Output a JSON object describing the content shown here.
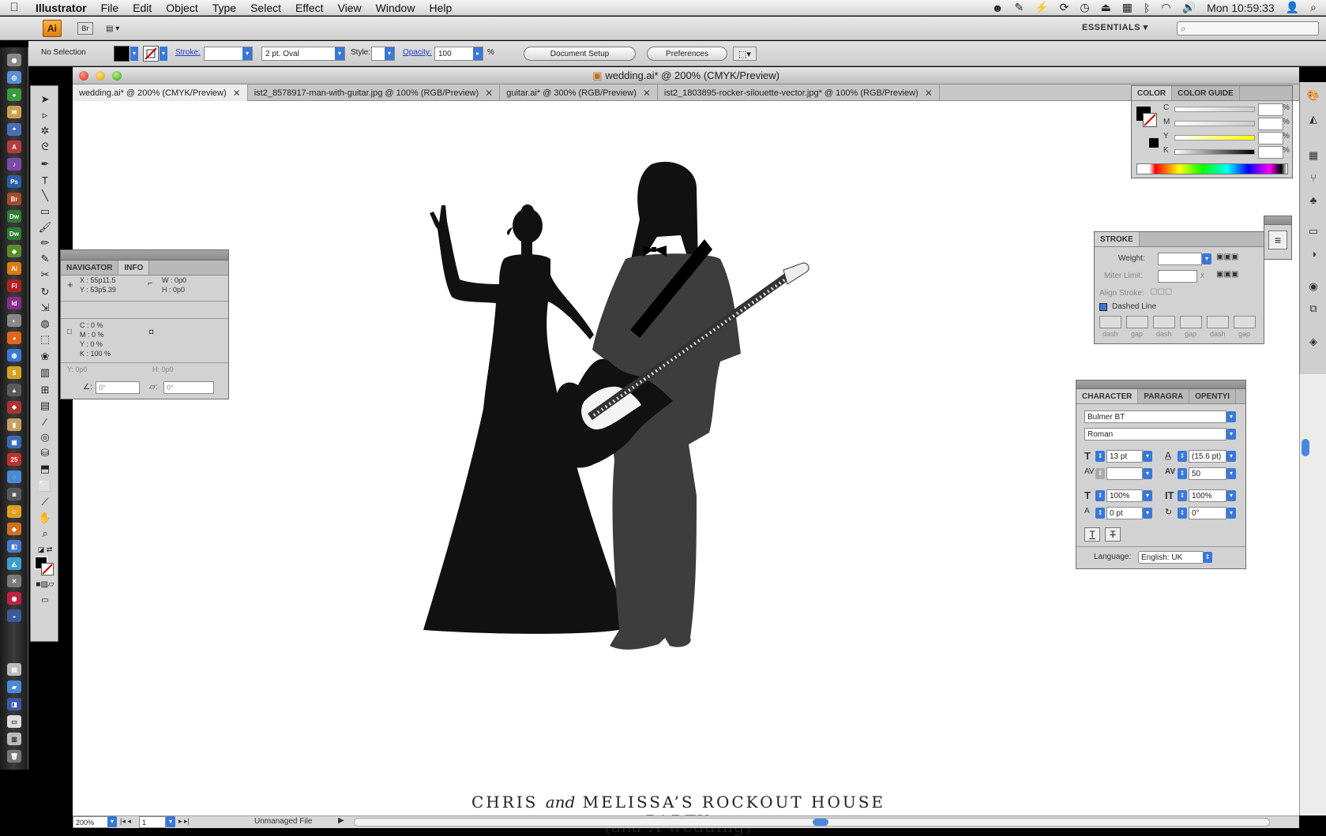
{
  "menubar": {
    "app_name": "Illustrator",
    "items": [
      "File",
      "Edit",
      "Object",
      "Type",
      "Select",
      "Effect",
      "View",
      "Window",
      "Help"
    ],
    "clock": "Mon 10:59:33"
  },
  "appbar": {
    "badge": "Ai",
    "bridge": "Br",
    "workspace": "ESSENTIALS ▾"
  },
  "control": {
    "selection": "No Selection",
    "stroke_label": "Stroke:",
    "brush": "2 pt. Oval",
    "style_label": "Style:",
    "opacity_label": "Opacity:",
    "opacity_value": "100",
    "opacity_unit": "%",
    "doc_setup": "Document Setup",
    "preferences": "Preferences"
  },
  "document": {
    "title": "wedding.ai* @ 200% (CMYK/Preview)",
    "tabs": [
      "wedding.ai* @ 200% (CMYK/Preview)",
      "ist2_8578917-man-with-guitar.jpg @ 100% (RGB/Preview)",
      "guitar.ai* @ 300% (RGB/Preview)",
      "ist2_1803895-rocker-silouette-vector.jpg* @ 100% (RGB/Preview)"
    ],
    "caption_line1_a": "CHRIS ",
    "caption_line1_b": "and",
    "caption_line1_c": " MELISSA’S ROCKOUT HOUSE PARTY",
    "caption_line2_a": "(",
    "caption_line2_b": "and",
    "caption_line2_c": " A wedding)"
  },
  "status": {
    "zoom": "200%",
    "page": "1",
    "file_state": "Unmanaged File"
  },
  "info_panel": {
    "tabs": [
      "NAVIGATOR",
      "INFO"
    ],
    "x": "X : 55p11.5",
    "y": "Y : 53p5.39",
    "w": "W : 0p0",
    "h": "H : 0p0",
    "c": "C : 0 %",
    "m": "M : 0 %",
    "yc": "Y : 0 %",
    "k": "K : 100 %",
    "under_y": "Y: 0p0",
    "under_h": "H: 0p0",
    "angle1": "0°",
    "angle2": "0°"
  },
  "color_panel": {
    "tabs": [
      "COLOR",
      "COLOR GUIDE"
    ],
    "channels": [
      "C",
      "M",
      "Y",
      "K"
    ],
    "unit": "%"
  },
  "stroke_panel": {
    "title": "STROKE",
    "weight": "Weight:",
    "miter": "Miter Limit:",
    "miter_x": "x",
    "align": "Align Stroke:",
    "dashed": "Dashed Line",
    "dash_labels": [
      "dash",
      "gap",
      "dash",
      "gap",
      "dash",
      "gap"
    ]
  },
  "character_panel": {
    "tabs": [
      "CHARACTER",
      "PARAGRA",
      "OPENTYI"
    ],
    "font": "Bulmer BT",
    "style": "Roman",
    "size": "13 pt",
    "leading": "(15.6 pt)",
    "tracking": "50",
    "hscale": "100%",
    "vscale": "100%",
    "baseline": "0 pt",
    "rotation": "0°",
    "language_label": "Language:",
    "language": "English: UK"
  },
  "colors": {
    "accent_blue": "#3a78d8",
    "canvas": "#ffffff",
    "silhouette": "#111111",
    "suit": "#3d3d3d"
  }
}
